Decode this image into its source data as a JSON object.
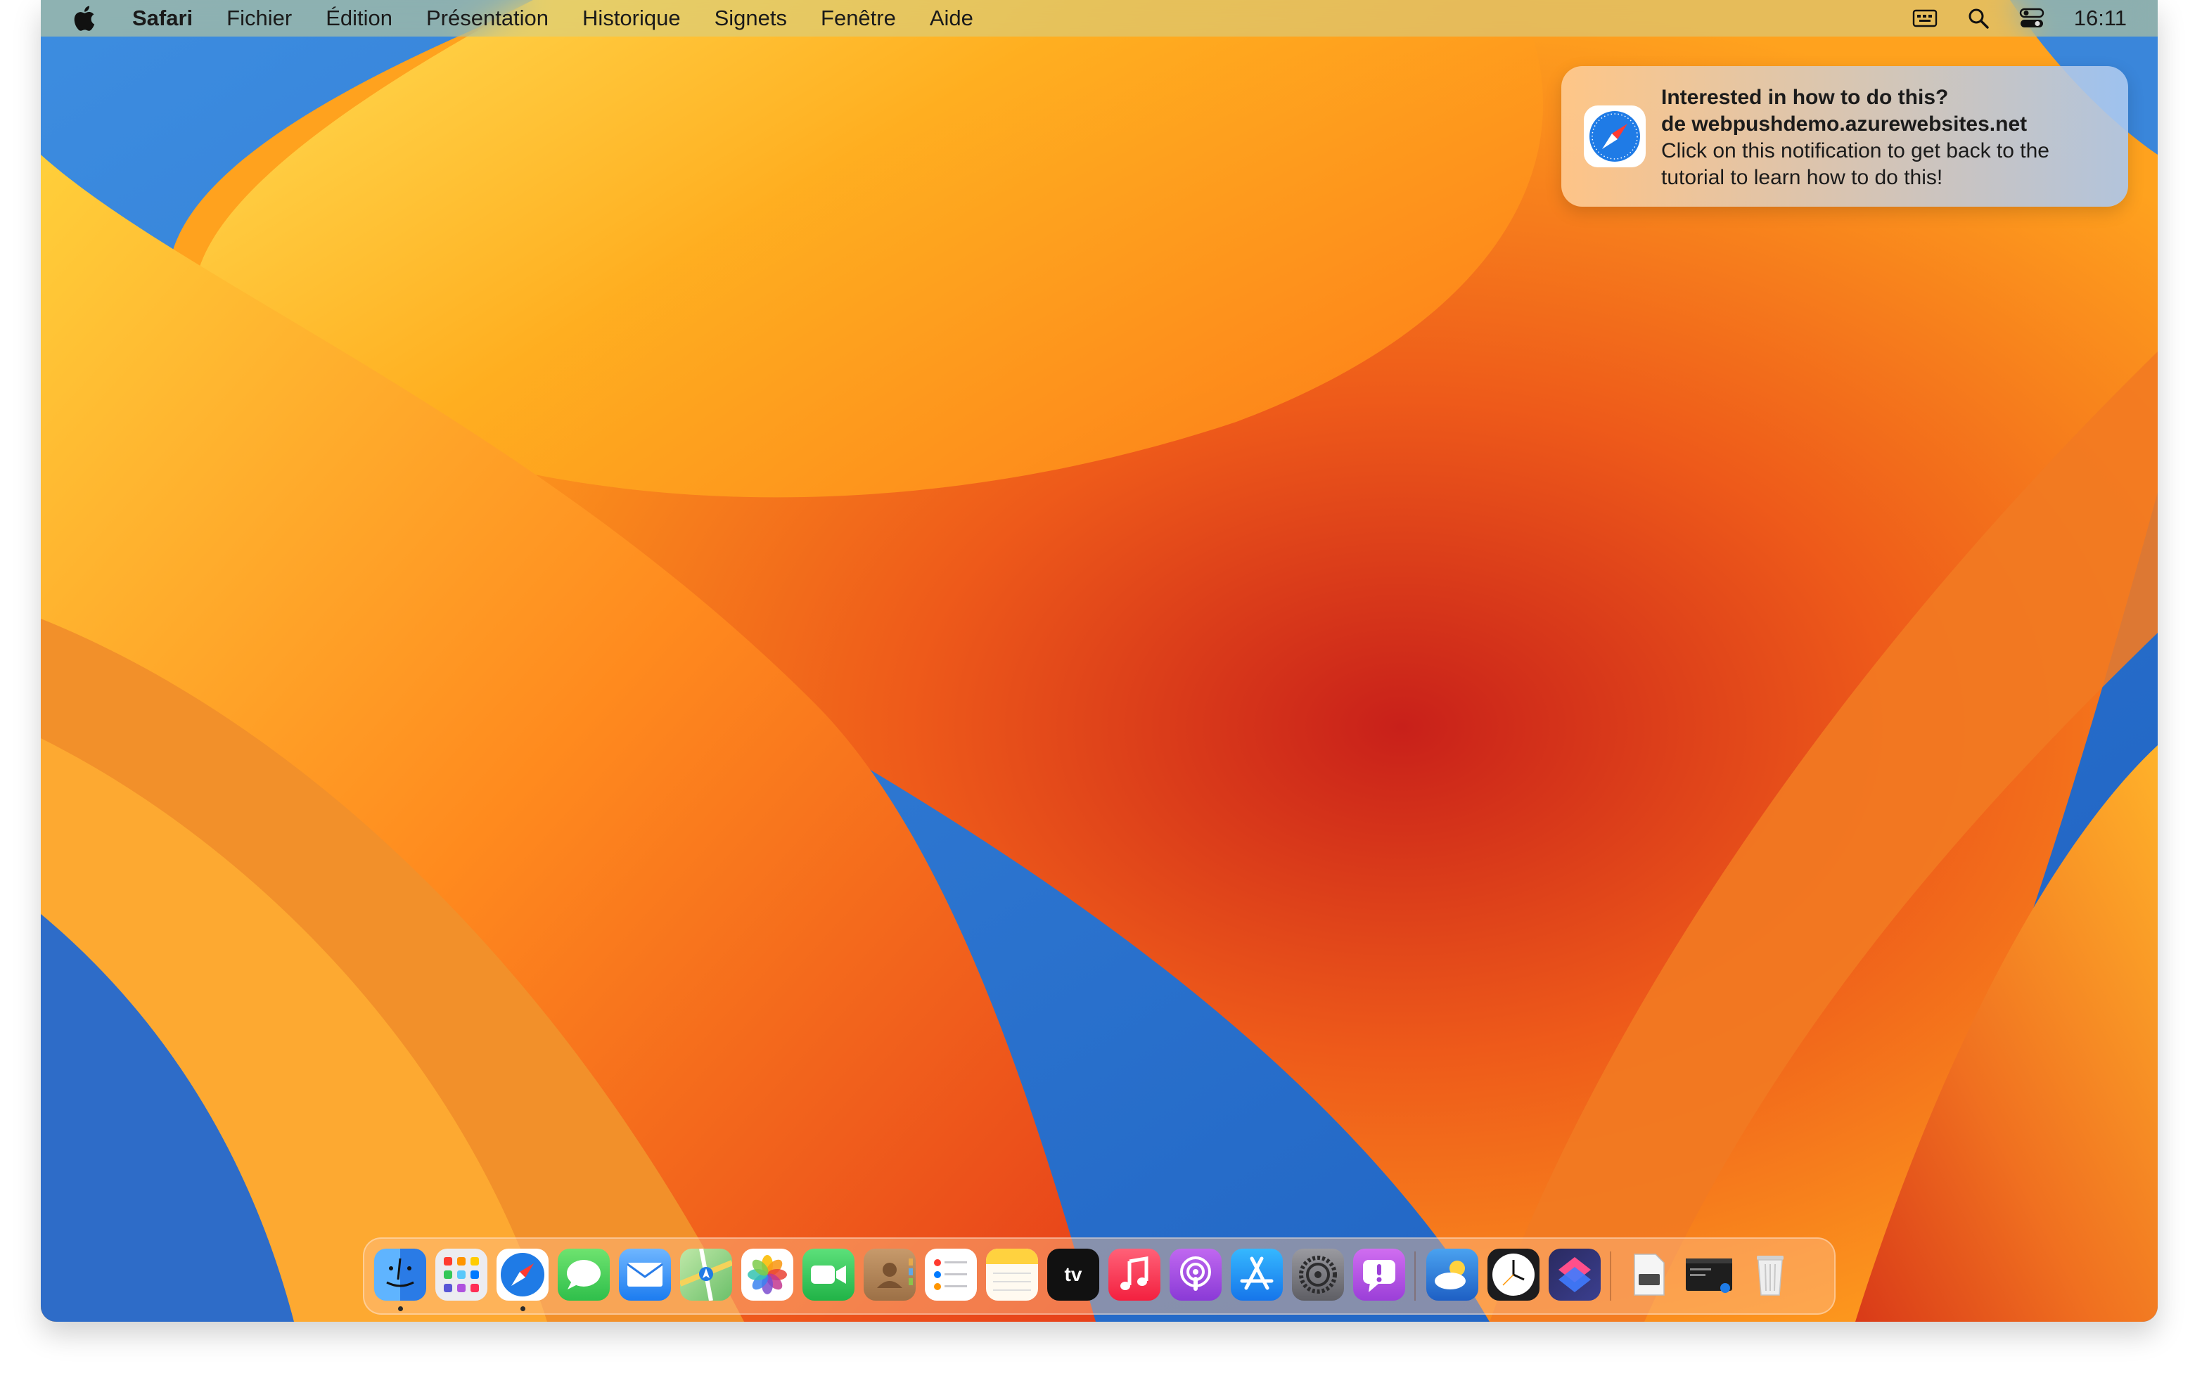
{
  "menubar": {
    "app_name": "Safari",
    "items": [
      "Fichier",
      "Édition",
      "Présentation",
      "Historique",
      "Signets",
      "Fenêtre",
      "Aide"
    ],
    "status_icons": [
      "input-menu-icon",
      "spotlight-search-icon",
      "control-center-icon"
    ],
    "clock": "16:11"
  },
  "notification": {
    "app_icon": "safari-compass-icon",
    "title": "Interested in how to do this?",
    "source": "de webpushdemo.azurewebsites.net",
    "body_line1": "Click on this notification to get back to the",
    "body_line2": "tutorial to learn how to do this!"
  },
  "dock": {
    "apps": [
      {
        "name": "Finder",
        "icon": "finder-icon",
        "running": true,
        "color": "#3a8ef0"
      },
      {
        "name": "Launchpad",
        "icon": "launchpad-icon",
        "running": false,
        "color": "#e9e9ee"
      },
      {
        "name": "Safari",
        "icon": "safari-icon",
        "running": true,
        "color": "#2f7de8"
      },
      {
        "name": "Messages",
        "icon": "messages-icon",
        "running": false,
        "color": "#34c759"
      },
      {
        "name": "Mail",
        "icon": "mail-icon",
        "running": false,
        "color": "#3b8ff5"
      },
      {
        "name": "Plans",
        "icon": "maps-icon",
        "running": false,
        "color": "#6cc06a"
      },
      {
        "name": "Photos",
        "icon": "photos-icon",
        "running": false,
        "color": "#ffffff"
      },
      {
        "name": "FaceTime",
        "icon": "facetime-icon",
        "running": false,
        "color": "#30c24f"
      },
      {
        "name": "Contacts",
        "icon": "contacts-icon",
        "running": false,
        "color": "#b98a5a"
      },
      {
        "name": "Rappels",
        "icon": "reminders-icon",
        "running": false,
        "color": "#ffffff"
      },
      {
        "name": "Notes",
        "icon": "notes-icon",
        "running": false,
        "color": "#fff7d6"
      },
      {
        "name": "TV",
        "icon": "apple-tv-icon",
        "running": false,
        "color": "#111111"
      },
      {
        "name": "Musique",
        "icon": "music-icon",
        "running": false,
        "color": "#fa3c55"
      },
      {
        "name": "Podcasts",
        "icon": "podcasts-icon",
        "running": false,
        "color": "#9b4ae0"
      },
      {
        "name": "App Store",
        "icon": "app-store-icon",
        "running": false,
        "color": "#1d8ff0"
      },
      {
        "name": "Réglages Système",
        "icon": "system-settings-icon",
        "running": false,
        "color": "#8e8e93"
      },
      {
        "name": "Feedback",
        "icon": "feedback-assistant-icon",
        "running": false,
        "color": "#b54ee0"
      },
      {
        "name": "Météo",
        "icon": "weather-icon",
        "running": false,
        "color": "#2b7de0"
      },
      {
        "name": "Horloge",
        "icon": "clock-icon",
        "running": false,
        "color": "#1c1c1e"
      },
      {
        "name": "Raccourcis",
        "icon": "shortcuts-icon",
        "running": false,
        "color": "#3b3f8f"
      },
      {
        "name": "Document",
        "icon": "document-icon",
        "running": false,
        "color": "#f2f2f2"
      },
      {
        "name": "Capture",
        "icon": "screenshot-window-icon",
        "running": false,
        "color": "#222222"
      },
      {
        "name": "Corbeille",
        "icon": "trash-icon",
        "running": false,
        "color": "#e6e6e6"
      }
    ]
  }
}
